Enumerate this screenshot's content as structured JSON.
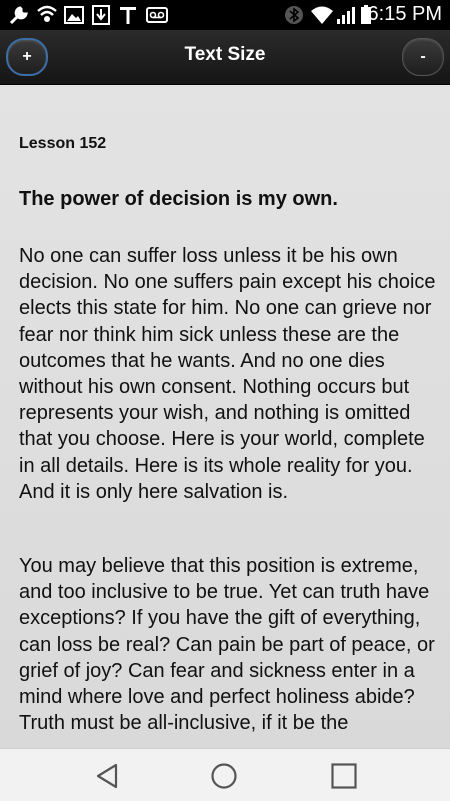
{
  "status_bar": {
    "time": "6:15 PM",
    "left_icons": [
      "wrench-icon",
      "wifi-call-icon",
      "image-icon",
      "download-icon",
      "tmobile-icon",
      "voicemail-icon"
    ],
    "right_icons": [
      "bluetooth-icon",
      "wifi-icon",
      "signal-icon",
      "battery-icon"
    ]
  },
  "title_bar": {
    "increase_label": "+",
    "title": "Text Size",
    "decrease_label": "-"
  },
  "content": {
    "lesson_label": "Lesson 152",
    "lesson_title": "The power of decision is my own.",
    "paragraphs": [
      "No one can suffer loss unless it be his own decision. No one suffers pain except his choice elects this state for him. No one can grieve nor fear nor think him sick unless these are the outcomes that he wants. And no one dies without his own consent. Nothing occurs but represents your wish, and nothing is omitted that you choose. Here is your world, complete in all details. Here is its whole reality for you. And it is only here salvation is.",
      "You may believe that this position is extreme, and too inclusive to be true. Yet can truth have exceptions? If you have the gift of everything, can loss be real? Can pain be part of peace, or grief of joy? Can fear and sickness enter in a mind where love and perfect holiness abide? Truth must be all-inclusive, if it be the"
    ]
  },
  "nav_bar": {
    "buttons": [
      "back-icon",
      "home-icon",
      "recents-icon"
    ]
  }
}
